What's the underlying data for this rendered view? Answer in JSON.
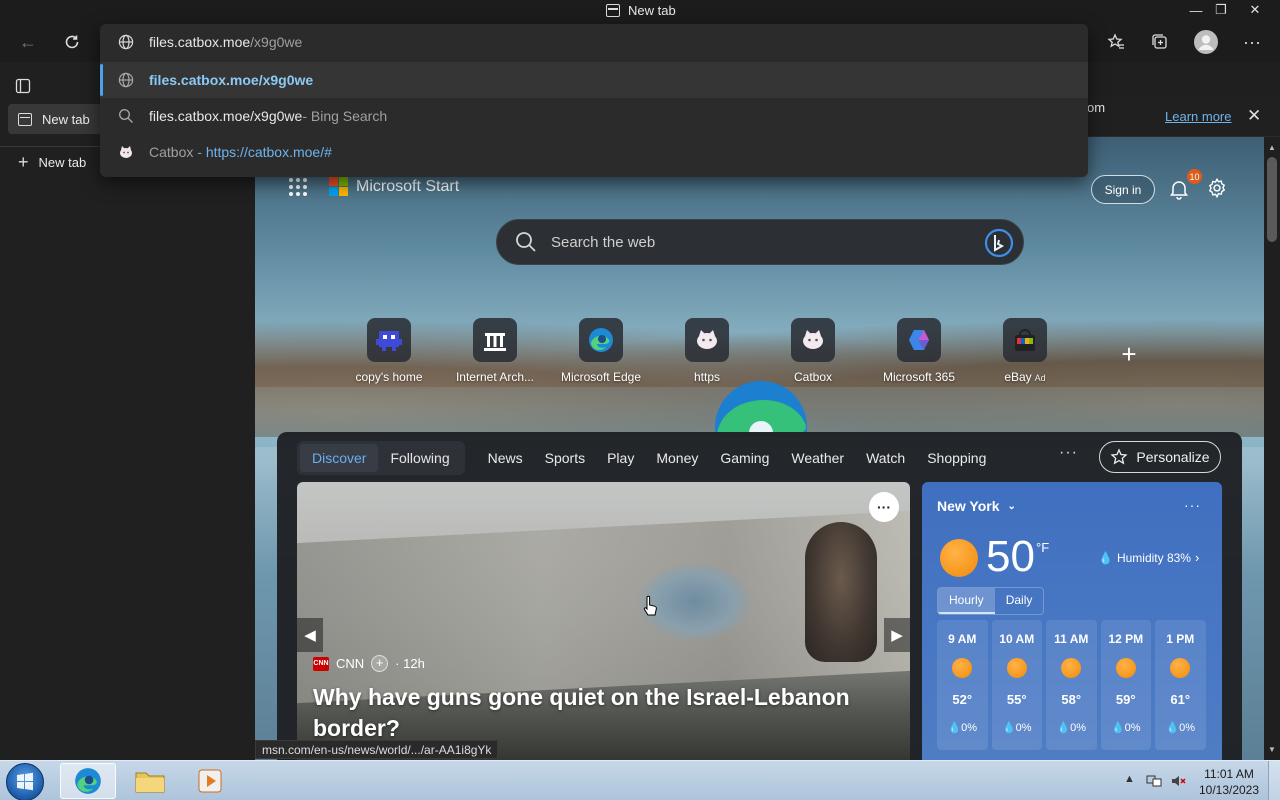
{
  "window": {
    "title": "New tab"
  },
  "toolbar": {
    "back": "back",
    "refresh": "refresh"
  },
  "address_dropdown": {
    "input_host": "files.catbox.moe",
    "input_path": "/x9g0we",
    "suggestions": [
      {
        "text": "files.catbox.moe/x9g0we",
        "type": "url"
      },
      {
        "text": "files.catbox.moe/x9g0we",
        "suffix": " - Bing Search",
        "type": "search"
      },
      {
        "text": "Catbox",
        "suffix": " - ",
        "link": "https://catbox.moe/#",
        "type": "site"
      }
    ]
  },
  "sidebar": {
    "tabs": [
      {
        "label": "New tab"
      }
    ],
    "new_tab_label": "New tab"
  },
  "infobar": {
    "text": "s from",
    "learn_more": "Learn more"
  },
  "ntp": {
    "brand": "Microsoft Start",
    "sign_in": "Sign in",
    "notifications": "10",
    "search_placeholder": "Search the web",
    "tiles": [
      {
        "label": "copy's home"
      },
      {
        "label": "Internet Arch..."
      },
      {
        "label": "Microsoft Edge"
      },
      {
        "label": "https"
      },
      {
        "label": "Catbox"
      },
      {
        "label": "Microsoft 365"
      },
      {
        "label": "eBay",
        "badge": "Ad"
      }
    ],
    "feed_tabs": [
      "Discover",
      "Following"
    ],
    "nav": [
      "News",
      "Sports",
      "Play",
      "Money",
      "Gaming",
      "Weather",
      "Watch",
      "Shopping"
    ],
    "more": "···",
    "personalize": "Personalize",
    "hero": {
      "source_logo": "CNN",
      "source": "CNN",
      "age": "· 12h",
      "headline": "Why have guns gone quiet on the Israel-Lebanon border?"
    },
    "weather": {
      "city": "New York",
      "temp": "50",
      "unit": "°F",
      "humidity": "Humidity 83%",
      "tabs": [
        "Hourly",
        "Daily"
      ],
      "hours": [
        {
          "time": "9 AM",
          "temp": "52°",
          "precip": "0%"
        },
        {
          "time": "10 AM",
          "temp": "55°",
          "precip": "0%"
        },
        {
          "time": "11 AM",
          "temp": "58°",
          "precip": "0%"
        },
        {
          "time": "12 PM",
          "temp": "59°",
          "precip": "0%"
        },
        {
          "time": "1 PM",
          "temp": "61°",
          "precip": "0%"
        }
      ]
    }
  },
  "status_url": "msn.com/en-us/news/world/.../ar-AA1i8gYk",
  "taskbar": {
    "time": "11:01 AM",
    "date": "10/13/2023"
  },
  "colors": {
    "accent": "#4ea1e6",
    "weather_bg": "#4776c3",
    "taskbar": "#b9cde1"
  }
}
